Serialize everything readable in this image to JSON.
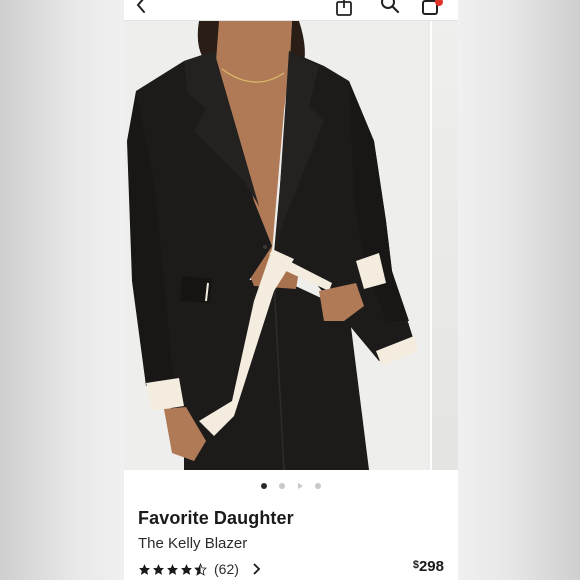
{
  "product": {
    "brand": "Favorite Daughter",
    "name": "The Kelly Blazer",
    "price_symbol": "$",
    "price_amount": "298",
    "rating": 4.5,
    "review_count": "(62)"
  },
  "gallery": {
    "image_count": 4,
    "active_index": 0,
    "image_subject": "model-wearing-black-blazer"
  },
  "icons": {
    "back": "chevron-left-icon",
    "share": "share-icon",
    "search": "search-icon",
    "bag": "shopping-bag-icon",
    "review_link": "chevron-right-icon"
  },
  "colors": {
    "blazer": "#1c1b1a",
    "trim": "#f3ecdf",
    "skin": "#b07a57",
    "bag_badge": "#e0322c",
    "text": "#1a1a1a"
  }
}
